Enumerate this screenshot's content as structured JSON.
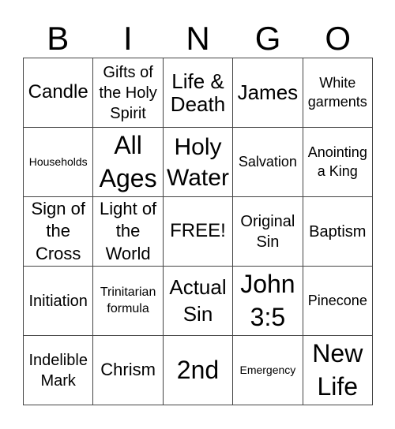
{
  "header": [
    "B",
    "I",
    "N",
    "G",
    "O"
  ],
  "cells": [
    [
      "Candle",
      "Gifts of the Holy Spirit",
      "Life & Death",
      "James",
      "White garments"
    ],
    [
      "Households",
      "All Ages",
      "Holy Water",
      "Salvation",
      "Anointing a King"
    ],
    [
      "Sign of the Cross",
      "Light of the World",
      "FREE!",
      "Original Sin",
      "Baptism"
    ],
    [
      "Initiation",
      "Trinitarian formula",
      "Actual Sin",
      "John 3:5",
      "Pinecone"
    ],
    [
      "Indelible Mark",
      "Chrism",
      "2nd",
      "Emergency",
      "New Life"
    ]
  ]
}
